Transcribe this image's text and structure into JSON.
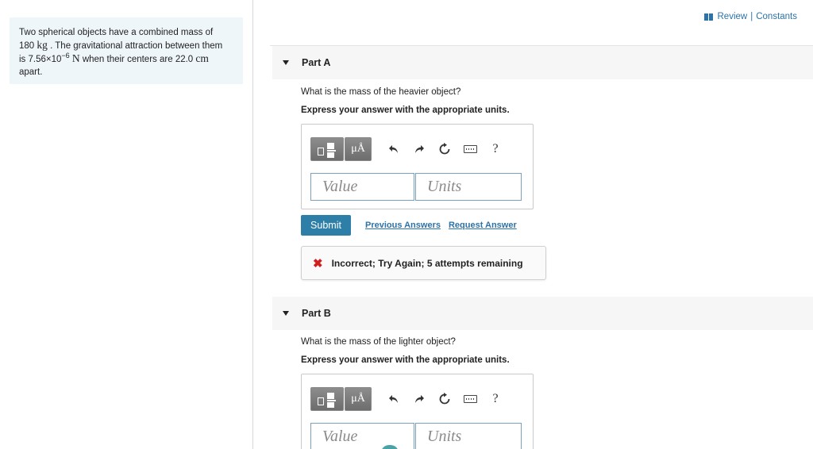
{
  "problem": {
    "t1": "Two spherical objects have a combined mass of",
    "mass_value": "180",
    "mass_unit": "kg",
    "t2": ". The gravitational attraction between them",
    "t3": "is 7.56×10",
    "exponent": "−6",
    "force_unit": "N",
    "t4": "when their centers are",
    "distance_value": "22.0",
    "distance_unit": "cm",
    "t5": "apart."
  },
  "top_links": {
    "review": "Review",
    "separator": "|",
    "constants": "Constants"
  },
  "parts": [
    {
      "label": "Part A",
      "question": "What is the mass of the heavier object?",
      "instruction": "Express your answer with the appropriate units.",
      "units_button": "μÅ",
      "help": "?",
      "value_placeholder": "Value",
      "units_placeholder": "Units",
      "submit": "Submit",
      "previous_answers": "Previous Answers",
      "request_answer": "Request Answer",
      "feedback_icon": "✖",
      "feedback": "Incorrect; Try Again; 5 attempts remaining"
    },
    {
      "label": "Part B",
      "question": "What is the mass of the lighter object?",
      "instruction": "Express your answer with the appropriate units.",
      "units_button": "μÅ",
      "help": "?",
      "value_placeholder": "Value",
      "units_placeholder": "Units"
    }
  ],
  "colors": {
    "accent": "#2e7fa7",
    "link": "#2b73a8",
    "error": "#d21e1e",
    "panel": "#eef6fa"
  }
}
